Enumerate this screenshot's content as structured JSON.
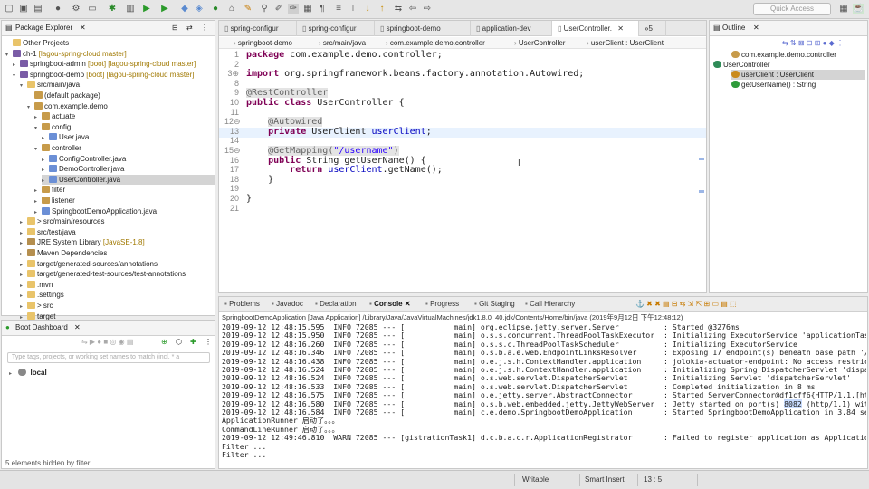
{
  "toolbar": {
    "quick_access_placeholder": "Quick Access"
  },
  "package_explorer": {
    "title": "Package Explorer",
    "close": "✕",
    "tree": [
      {
        "label": "Other Projects",
        "extra": "",
        "indent": 0,
        "arrow": "",
        "icon": "folder"
      },
      {
        "label": "ch-1",
        "extra": "[lagou-spring-cloud master]",
        "indent": 0,
        "arrow": "▾",
        "icon": "project"
      },
      {
        "label": "springboot-admin",
        "extra": "[boot] [lagou-spring-cloud master]",
        "indent": 1,
        "arrow": "▸",
        "icon": "project"
      },
      {
        "label": "springboot-demo",
        "extra": "[boot] [lagou-spring-cloud master]",
        "indent": 1,
        "arrow": "▾",
        "icon": "project"
      },
      {
        "label": "src/main/java",
        "extra": "",
        "indent": 2,
        "arrow": "▾",
        "icon": "folder"
      },
      {
        "label": "(default package)",
        "extra": "",
        "indent": 3,
        "arrow": "",
        "icon": "pkg"
      },
      {
        "label": "com.example.demo",
        "extra": "",
        "indent": 3,
        "arrow": "▾",
        "icon": "pkg"
      },
      {
        "label": "actuate",
        "extra": "",
        "indent": 4,
        "arrow": "▸",
        "icon": "pkg"
      },
      {
        "label": "config",
        "extra": "",
        "indent": 4,
        "arrow": "▾",
        "icon": "pkg"
      },
      {
        "label": "User.java",
        "extra": "",
        "indent": 5,
        "arrow": "▸",
        "icon": "java"
      },
      {
        "label": "controller",
        "extra": "",
        "indent": 4,
        "arrow": "▾",
        "icon": "pkg"
      },
      {
        "label": "ConfigController.java",
        "extra": "",
        "indent": 5,
        "arrow": "▸",
        "icon": "java"
      },
      {
        "label": "DemoController.java",
        "extra": "",
        "indent": 5,
        "arrow": "▸",
        "icon": "java"
      },
      {
        "label": "UserController.java",
        "extra": "",
        "indent": 5,
        "arrow": "▸",
        "icon": "java",
        "selected": true
      },
      {
        "label": "filter",
        "extra": "",
        "indent": 4,
        "arrow": "▸",
        "icon": "pkg"
      },
      {
        "label": "listener",
        "extra": "",
        "indent": 4,
        "arrow": "▸",
        "icon": "pkg"
      },
      {
        "label": "SpringbootDemoApplication.java",
        "extra": "",
        "indent": 4,
        "arrow": "▸",
        "icon": "java"
      },
      {
        "label": "> src/main/resources",
        "extra": "",
        "indent": 2,
        "arrow": "▸",
        "icon": "folder"
      },
      {
        "label": "src/test/java",
        "extra": "",
        "indent": 2,
        "arrow": "▸",
        "icon": "folder"
      },
      {
        "label": "JRE System Library",
        "extra": "[JavaSE-1.8]",
        "indent": 2,
        "arrow": "▸",
        "icon": "lib"
      },
      {
        "label": "Maven Dependencies",
        "extra": "",
        "indent": 2,
        "arrow": "▸",
        "icon": "lib"
      },
      {
        "label": "target/generated-sources/annotations",
        "extra": "",
        "indent": 2,
        "arrow": "▸",
        "icon": "folder"
      },
      {
        "label": "target/generated-test-sources/test-annotations",
        "extra": "",
        "indent": 2,
        "arrow": "▸",
        "icon": "folder"
      },
      {
        "label": ".mvn",
        "extra": "",
        "indent": 2,
        "arrow": "▸",
        "icon": "folder"
      },
      {
        "label": ".settings",
        "extra": "",
        "indent": 2,
        "arrow": "▸",
        "icon": "folder"
      },
      {
        "label": "> src",
        "extra": "",
        "indent": 2,
        "arrow": "▸",
        "icon": "folder"
      },
      {
        "label": "target",
        "extra": "",
        "indent": 2,
        "arrow": "▸",
        "icon": "folder"
      }
    ]
  },
  "boot_dashboard": {
    "title": "Boot Dashboard",
    "close": "✕",
    "search_placeholder": "Type tags, projects, or working set names to match (incl. * a",
    "local_label": "local",
    "footer": "5 elements hidden by filter"
  },
  "editor": {
    "tabs": [
      {
        "label": "spring-configur",
        "active": false
      },
      {
        "label": "spring-configur",
        "active": false
      },
      {
        "label": "springboot-demo",
        "active": false
      },
      {
        "label": "application-dev",
        "active": false
      },
      {
        "label": "UserController.",
        "active": true
      },
      {
        "label": "»5",
        "active": false
      }
    ],
    "breadcrumb": [
      "springboot-demo",
      "src/main/java",
      "com.example.demo.controller",
      "UserController",
      "userClient : UserClient"
    ],
    "highlight_line": 13,
    "lines": [
      {
        "n": "1",
        "html": "<span class='kw'>package</span> com.example.demo.controller;"
      },
      {
        "n": "2",
        "html": ""
      },
      {
        "n": "3⊕",
        "html": "<span class='kw'>import</span> org.springframework.beans.factory.annotation.Autowired;"
      },
      {
        "n": "8",
        "html": ""
      },
      {
        "n": "9",
        "html": "<span class='ann'>@RestController</span>"
      },
      {
        "n": "10",
        "html": "<span class='kw'>public class</span> UserController {"
      },
      {
        "n": "11",
        "html": ""
      },
      {
        "n": "12⊖",
        "html": "    <span class='ann'>@Autowired</span>"
      },
      {
        "n": "13",
        "html": "    <span class='kw'>private</span> UserClient <span class='fld'>userClient</span>;"
      },
      {
        "n": "14",
        "html": ""
      },
      {
        "n": "15⊖",
        "html": "    <span class='ann'>@GetMapping(<span class='str'>\"/username\"</span>)</span>"
      },
      {
        "n": "16",
        "html": "    <span class='kw'>public</span> String getUserName() {"
      },
      {
        "n": "17",
        "html": "        <span class='kw'>return</span> <span class='fld'>userClient</span>.getName();"
      },
      {
        "n": "18",
        "html": "    }"
      },
      {
        "n": "19",
        "html": ""
      },
      {
        "n": "20",
        "html": "}"
      },
      {
        "n": "21",
        "html": ""
      }
    ]
  },
  "outline": {
    "title": "Outline",
    "close": "✕",
    "items": [
      {
        "label": "com.example.demo.controller",
        "indent": 1,
        "selected": false,
        "color": "#c79b4a"
      },
      {
        "label": "UserController",
        "indent": 0,
        "selected": false,
        "color": "#2e8b57"
      },
      {
        "label": "userClient : UserClient",
        "indent": 1,
        "selected": true,
        "color": "#c98b1e"
      },
      {
        "label": "getUserName() : String",
        "indent": 1,
        "selected": false,
        "color": "#2e9b3a"
      }
    ]
  },
  "console": {
    "tabs": [
      {
        "label": "Problems",
        "active": false
      },
      {
        "label": "Javadoc",
        "active": false
      },
      {
        "label": "Declaration",
        "active": false
      },
      {
        "label": "Console",
        "active": true
      },
      {
        "label": "Progress",
        "active": false
      },
      {
        "label": "Git Staging",
        "active": false
      },
      {
        "label": "Call Hierarchy",
        "active": false
      }
    ],
    "header": "SpringbootDemoApplication [Java Application] /Library/Java/JavaVirtualMachines/jdk1.8.0_40.jdk/Contents/Home/bin/java (2019年9月12日 下午12:48:12)",
    "lines": [
      "2019-09-12 12:48:15.595  INFO 72085 --- [           main] org.eclipse.jetty.server.Server          : Started @3276ms",
      "2019-09-12 12:48:15.950  INFO 72085 --- [           main] o.s.s.concurrent.ThreadPoolTaskExecutor  : Initializing ExecutorService 'applicationTaskEx",
      "2019-09-12 12:48:16.260  INFO 72085 --- [           main] o.s.s.c.ThreadPoolTaskScheduler          : Initializing ExecutorService",
      "2019-09-12 12:48:16.346  INFO 72085 --- [           main] o.s.b.a.e.web.EndpointLinksResolver      : Exposing 17 endpoint(s) beneath base path '/act",
      "2019-09-12 12:48:16.438  INFO 72085 --- [           main] o.e.j.s.h.ContextHandler.application     : jolokia-actuator-endpoint: No access restrictor",
      "2019-09-12 12:48:16.524  INFO 72085 --- [           main] o.e.j.s.h.ContextHandler.application     : Initializing Spring DispatcherServlet 'dispatch",
      "2019-09-12 12:48:16.524  INFO 72085 --- [           main] o.s.web.servlet.DispatcherServlet        : Initializing Servlet 'dispatcherServlet'",
      "2019-09-12 12:48:16.533  INFO 72085 --- [           main] o.s.web.servlet.DispatcherServlet        : Completed initialization in 8 ms",
      "2019-09-12 12:48:16.575  INFO 72085 --- [           main] o.e.jetty.server.AbstractConnector       : Started ServerConnector@df1cff6{HTTP/1.1,[http/",
      "2019-09-12 12:48:16.580  INFO 72085 --- [           main] o.s.b.web.embedded.jetty.JettyWebServer  : Jetty started on port(s) 8082 (http/1.1) with c",
      "2019-09-12 12:48:16.584  INFO 72085 --- [           main] c.e.demo.SpringbootDemoApplication       : Started SpringbootDemoApplication in 3.84 secon",
      "ApplicationRunner 启动了。。。",
      "CommandLineRunner 启动了。。。",
      "2019-09-12 12:49:46.810  WARN 72085 --- [gistrationTask1] d.c.b.a.c.r.ApplicationRegistrator       : Failed to register application as Application(n",
      "Filter ...",
      "Filter ..."
    ]
  },
  "status": {
    "writable": "Writable",
    "insert_mode": "Smart Insert",
    "position": "13 : 5"
  }
}
